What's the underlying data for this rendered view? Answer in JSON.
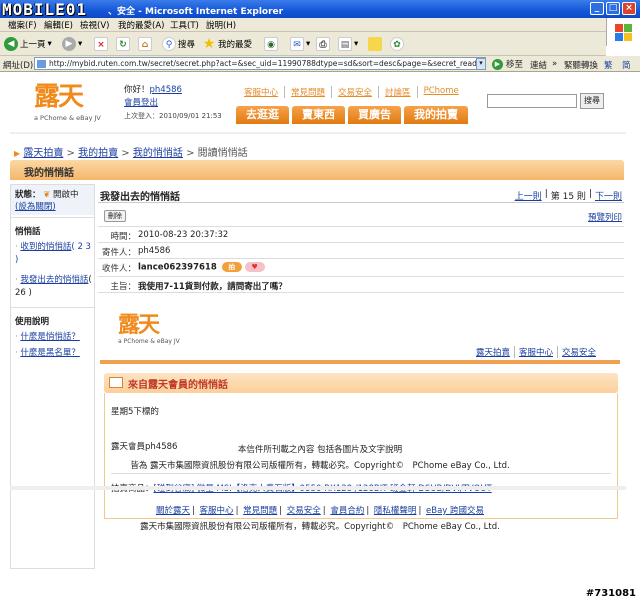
{
  "window": {
    "title": "、安全 - Microsoft Internet Explorer",
    "watermark_logo": "MOBILE01"
  },
  "menu": [
    "檔案(F)",
    "編輯(E)",
    "檢視(V)",
    "我的最愛(A)",
    "工具(T)",
    "說明(H)"
  ],
  "toolbar": {
    "back": "上一頁",
    "search": "搜尋",
    "favorites": "我的最愛"
  },
  "address": {
    "label": "網址(D)",
    "url": "http://mybid.ruten.com.tw/secret/secret.php?act=&sec_uid=11990788dtype=sd&sort=desc&page=&secret_read_type=one&se",
    "go": "移至",
    "links": "連結",
    "tool1": "緊聽轉換",
    "tool2": "繁",
    "tool3": "简"
  },
  "site": {
    "logo_text": "露天",
    "logo_badge": "拍賣",
    "logo_sub": "a PChome & eBay JV",
    "greeting": "你好！",
    "username": "ph4586",
    "logout": "會員登出",
    "last_login": "上次登入：2010/09/01 21:53",
    "topnav": [
      "客服中心",
      "常見問題",
      "交易安全",
      "討論區",
      "PChome"
    ],
    "tabs": [
      "去逛逛",
      "賣東西",
      "買廣告",
      "我的拍賣"
    ],
    "search_button": "搜尋"
  },
  "breadcrumb": {
    "items": [
      "露天拍賣",
      "我的拍賣",
      "我的悄悄話"
    ],
    "current": "閱讀悄悄話",
    "sep": ">"
  },
  "page_header": "我的悄悄話",
  "sidebar": {
    "status_label": "狀態：",
    "status_value": "開啟中",
    "status_toggle": "(設為關閉)",
    "section1": "悄悄話",
    "received": "收到的悄悄話",
    "received_count": "( 2 3 )",
    "sent": "我發出去的悄悄話",
    "sent_count": "( 26 )",
    "section2": "使用說明",
    "help1": "什麼是悄悄話？",
    "help2": "什麼是黑名單？"
  },
  "message": {
    "title": "我發出去的悄悄話",
    "pager": {
      "prev": "上一則",
      "current": "第 15 則",
      "next": "下一則",
      "sep1": "|",
      "sep2": "|"
    },
    "delete": "刪除",
    "preview": "預覽列印",
    "time_label": "時間：",
    "time": "2010-08-23 20:37:32",
    "sender_label": "寄件人：",
    "sender": "ph4586",
    "recipient_label": "收件人：",
    "recipient": "lance062397618",
    "recipient_badge": "拍",
    "subject_label": "主旨：",
    "subject": "我使用7-11貨到付款，請問寄出了嗎？"
  },
  "inner": {
    "nav": [
      "露天拍賣",
      "客服中心",
      "交易安全"
    ],
    "card_title": "來自露天會員的悄悄話",
    "body1": "星期5下標的",
    "body2": "露天會員ph4586",
    "product_label": "拍賣商品：",
    "product_link": "[碰到谷底] 微星 MSI【洛克人費石版】9550 RX128 /128BIT 班金軒 DSUB/DVI/TVOUT"
  },
  "footer": {
    "line1": "本信件所刊載之內容 包括各圖片及文字說明",
    "line2": "皆為 露天市集國際資訊股份有限公司版權所有，轉載必究。Copyright©　PChome eBay Co., Ltd.",
    "links": [
      "關於露天",
      "客服中心",
      "常見問題",
      "交易安全",
      "會員合約",
      "隱私權聲明",
      "eBay 跨國交易"
    ],
    "copyright": "露天市集國際資訊股份有限公司版權所有，轉載必究。Copyright©　PChome eBay Co., Ltd."
  },
  "watermark": "#731081"
}
